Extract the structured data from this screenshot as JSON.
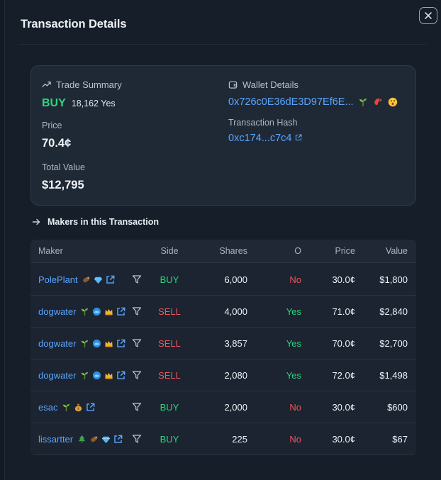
{
  "modal": {
    "title": "Transaction Details"
  },
  "summary": {
    "trade_heading": "Trade Summary",
    "side": "BUY",
    "shares": "18,162 Yes",
    "price_label": "Price",
    "price_value": "70.4¢",
    "total_label": "Total Value",
    "total_value": "$12,795",
    "wallet_heading": "Wallet Details",
    "wallet_address": "0x726c0E36dE3D97Ef6E...",
    "wallet_badges": [
      "seedling-icon",
      "shrimp-icon",
      "surprised-face-icon"
    ],
    "hash_label": "Transaction Hash",
    "hash_value": "0xc174...c7c4"
  },
  "makers": {
    "heading": "Makers in this Transaction",
    "columns": [
      "Maker",
      "Side",
      "Shares",
      "O",
      "Price",
      "Value"
    ],
    "rows": [
      {
        "maker": "PolePlant",
        "badges": [
          "log-icon",
          "diamond-icon"
        ],
        "side": "BUY",
        "shares": "6,000",
        "outcome": "No",
        "price": "30.0¢",
        "value": "$1,800"
      },
      {
        "maker": "dogwater",
        "badges": [
          "seedling-icon",
          "whale-icon",
          "crown-icon"
        ],
        "side": "SELL",
        "shares": "4,000",
        "outcome": "Yes",
        "price": "71.0¢",
        "value": "$2,840"
      },
      {
        "maker": "dogwater",
        "badges": [
          "seedling-icon",
          "whale-icon",
          "crown-icon"
        ],
        "side": "SELL",
        "shares": "3,857",
        "outcome": "Yes",
        "price": "70.0¢",
        "value": "$2,700"
      },
      {
        "maker": "dogwater",
        "badges": [
          "seedling-icon",
          "whale-icon",
          "crown-icon"
        ],
        "side": "SELL",
        "shares": "2,080",
        "outcome": "Yes",
        "price": "72.0¢",
        "value": "$1,498"
      },
      {
        "maker": "esac",
        "badges": [
          "seedling-icon",
          "money-bag-icon"
        ],
        "side": "BUY",
        "shares": "2,000",
        "outcome": "No",
        "price": "30.0¢",
        "value": "$600"
      },
      {
        "maker": "lissartter",
        "badges": [
          "tree-icon",
          "log-icon",
          "diamond-icon"
        ],
        "side": "BUY",
        "shares": "225",
        "outcome": "No",
        "price": "30.0¢",
        "value": "$67"
      }
    ]
  },
  "colors": {
    "buy": "#2fd57b",
    "sell": "#f0565c",
    "link": "#5aa5ff",
    "panel": "#161e29",
    "card": "#1f2935"
  }
}
